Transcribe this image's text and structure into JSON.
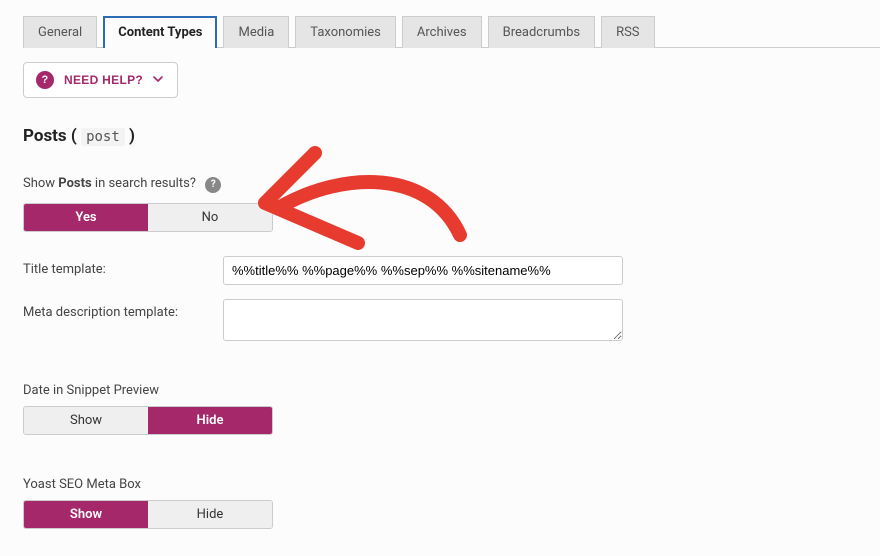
{
  "tabs": [
    {
      "label": "General"
    },
    {
      "label": "Content Types"
    },
    {
      "label": "Media"
    },
    {
      "label": "Taxonomies"
    },
    {
      "label": "Archives"
    },
    {
      "label": "Breadcrumbs"
    },
    {
      "label": "RSS"
    }
  ],
  "help_button": {
    "label": "NEED HELP?"
  },
  "section": {
    "title_prefix": "Posts ( ",
    "title_code": "post",
    "title_suffix": " )"
  },
  "show_in_results": {
    "label_prefix": "Show ",
    "label_strong": "Posts",
    "label_suffix": " in search results?",
    "yes": "Yes",
    "no": "No"
  },
  "title_template": {
    "label": "Title template:",
    "value": "%%title%% %%page%% %%sep%% %%sitename%%"
  },
  "meta_desc": {
    "label": "Meta description template:",
    "value": ""
  },
  "date_snippet": {
    "label": "Date in Snippet Preview",
    "show": "Show",
    "hide": "Hide"
  },
  "meta_box": {
    "label": "Yoast SEO Meta Box",
    "show": "Show",
    "hide": "Hide"
  }
}
